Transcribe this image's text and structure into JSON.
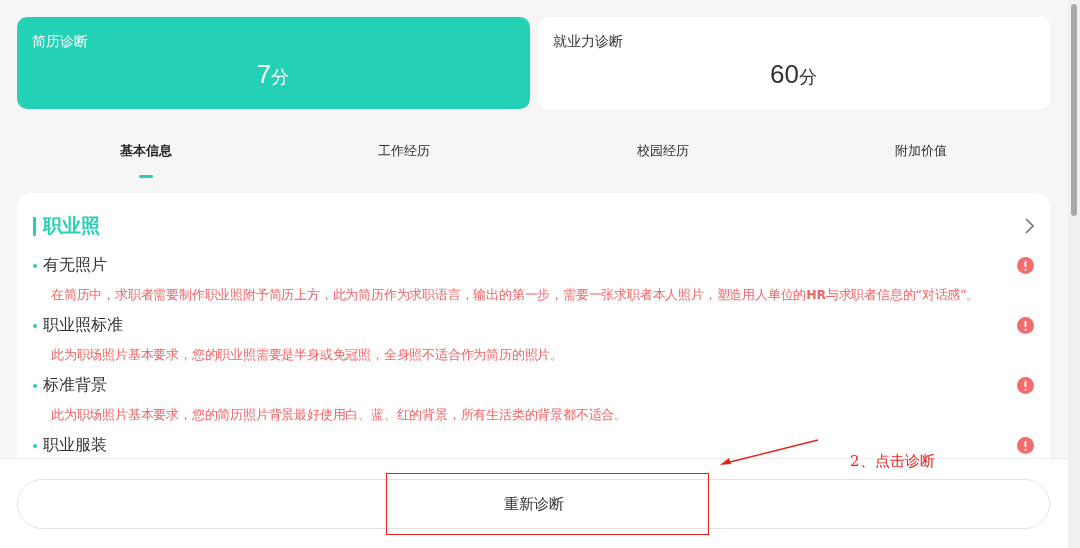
{
  "score_cards": [
    {
      "label": "简历诊断",
      "score": "7",
      "unit": "分",
      "selected": true
    },
    {
      "label": "就业力诊断",
      "score": "60",
      "unit": "分",
      "selected": false
    }
  ],
  "tabs": [
    {
      "label": "基本信息",
      "selected": true
    },
    {
      "label": "工作经历",
      "selected": false
    },
    {
      "label": "校园经历",
      "selected": false
    },
    {
      "label": "附加价值",
      "selected": false
    }
  ],
  "section": {
    "title": "职业照",
    "items": [
      {
        "title": "有无照片",
        "kind": "error",
        "description": "在简历中，求职者需要制作职业照附予简历上方，此为简历作为求职语言，输出的第一步，需要一张求职者本人照片，塑造用人单位的**HR**与求职者信息的“对话感”。"
      },
      {
        "title": "职业照标准",
        "kind": "error",
        "description": "此为职场照片基本要求，您的职业照需要是半身或免冠照，全身照不适合作为简历的照片。"
      },
      {
        "title": "标准背景",
        "kind": "error",
        "description": "此为职场照片基本要求，您的简历照片背景最好使用白、蓝、红的背景，所有生活类的背景都不适合。"
      },
      {
        "title": "职业服装",
        "kind": "error"
      }
    ]
  },
  "action_button": "重新诊断",
  "annotation": {
    "text": "2、点击诊断"
  }
}
